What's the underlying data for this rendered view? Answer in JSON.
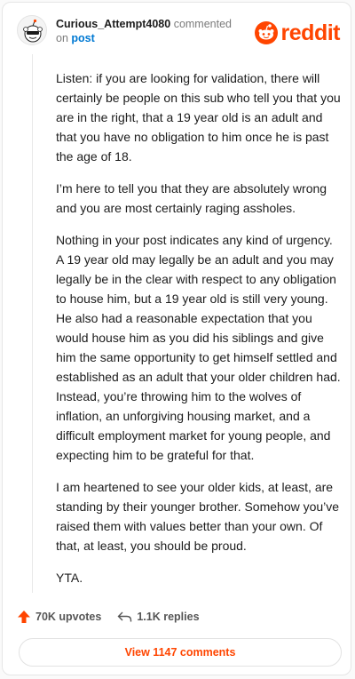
{
  "header": {
    "username": "Curious_Attempt4080",
    "commented": "commented",
    "on": "on",
    "post_link": "post",
    "brand": "reddit"
  },
  "comment": {
    "paragraphs": [
      "Listen: if you are looking for validation, there will certainly be people on this sub who tell you that you are in the right, that a 19 year old is an adult and that you have no obligation to him once he is past the age of 18.",
      "I’m here to tell you that they are absolutely wrong and you are most certainly raging assholes.",
      "Nothing in your post indicates any kind of urgency. A 19 year old may legally be an adult and you may legally be in the clear with respect to any obligation to house him, but a 19 year old is still very young. He also had a reasonable expectation that you would house him as you did his siblings and give him the same opportunity to get himself settled and established as an adult that your older children had. Instead, you’re throwing him to the wolves of inflation, an unforgiving housing market, and a difficult employment market for young people, and expecting him to be grateful for that.",
      "I am heartened to see your older kids, at least, are standing by their younger brother. Somehow you’ve raised them with values better than your own. Of that, at least, you should be proud.",
      "YTA."
    ]
  },
  "actions": {
    "upvotes": "70K upvotes",
    "replies": "1.1K replies",
    "view_comments": "View 1147 comments"
  },
  "colors": {
    "brand": "#ff4500",
    "link": "#0079d3"
  },
  "icons": [
    "avatar-snoo-icon",
    "reddit-logo-icon",
    "upvote-arrow-icon",
    "reply-icon"
  ]
}
